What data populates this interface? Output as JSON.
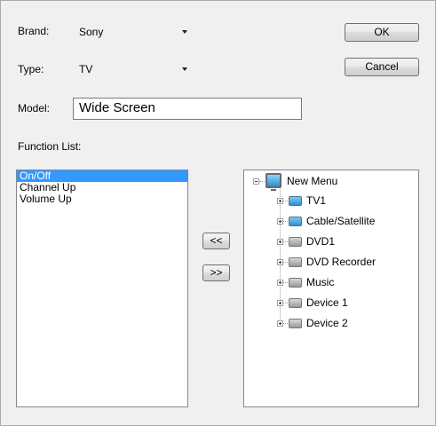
{
  "form": {
    "brand_label": "Brand:",
    "brand_value": "Sony",
    "type_label": "Type:",
    "type_value": "TV",
    "model_label": "Model:",
    "model_value": "Wide Screen",
    "function_list_label": "Function List:"
  },
  "buttons": {
    "ok": "OK",
    "cancel": "Cancel",
    "move_left": "<<",
    "move_right": ">>"
  },
  "function_list": {
    "items": [
      "On/Off",
      "Channel Up",
      "Volume Up"
    ],
    "selected": "On/Off"
  },
  "tree": {
    "root": "New Menu",
    "children": [
      {
        "label": "TV1",
        "icon": "tv-icon"
      },
      {
        "label": "Cable/Satellite",
        "icon": "tv-icon"
      },
      {
        "label": "DVD1",
        "icon": "device-icon"
      },
      {
        "label": "DVD Recorder",
        "icon": "device-icon"
      },
      {
        "label": "Music",
        "icon": "device-icon"
      },
      {
        "label": "Device 1",
        "icon": "device-icon"
      },
      {
        "label": "Device 2",
        "icon": "device-icon"
      }
    ]
  }
}
